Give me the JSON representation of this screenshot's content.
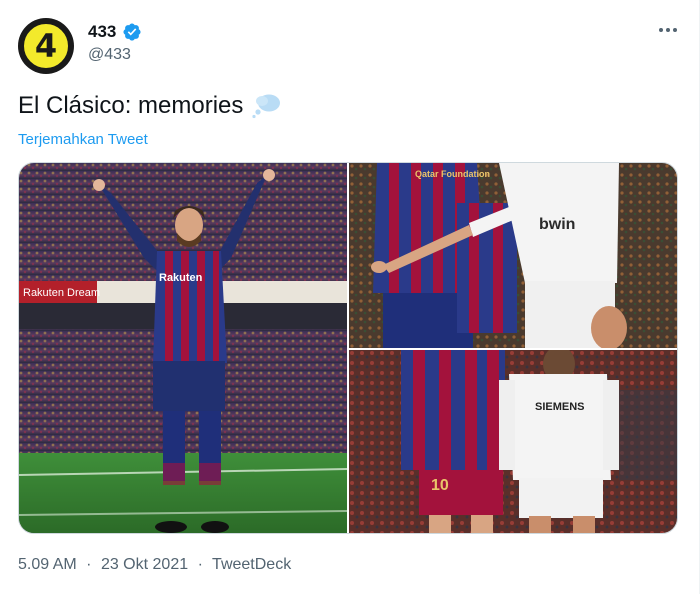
{
  "author": {
    "avatar_text": "4",
    "display_name": "433",
    "handle": "@433",
    "verified_icon": "verified-badge-icon"
  },
  "tweet": {
    "text": "El Clásico: memories",
    "emoji_icon": "thought-bubble-icon",
    "translate_label": "Terjemahkan Tweet"
  },
  "media": {
    "left_photo": {
      "banner_text_1": "Rakuten",
      "shirt_text": "Rakuten"
    },
    "top_right_photo": {
      "shirt_text_1": "Qatar Foundation",
      "shirt_text_2": "bwin"
    },
    "bottom_right_photo": {
      "shirt_text": "SIEMENS",
      "shirt_number": "10"
    }
  },
  "meta": {
    "time": "5.09 AM",
    "sep1": "·",
    "date": "23 Okt 2021",
    "sep2": "·",
    "source": "TweetDeck"
  },
  "colors": {
    "link": "#1d9bf0",
    "secondary_text": "#536471",
    "barca_blue": "#1f2f7a",
    "barca_red": "#a3123c",
    "madrid_white": "#f2f2f2",
    "pitch_green": "#2f7d2a"
  }
}
